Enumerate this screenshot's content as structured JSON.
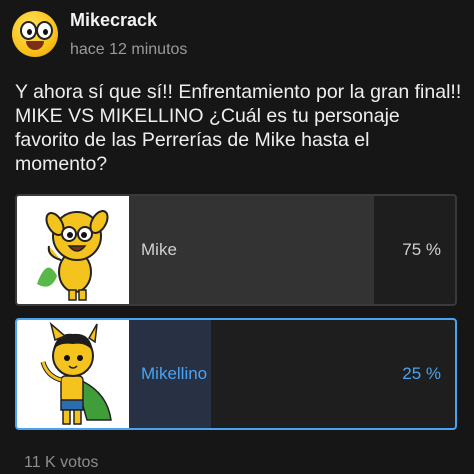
{
  "post": {
    "author": "Mikecrack",
    "time": "hace 12 minutos",
    "text": "Y ahora sí que sí!! Enfrentamiento por la gran final!! MIKE VS MIKELLINO ¿Cuál es tu personaje favorito de las Perrerías de Mike hasta el momento?"
  },
  "poll": {
    "options": [
      {
        "label": "Mike",
        "percent_label": "75 %",
        "fraction": 0.75,
        "selected": false,
        "image": "mike-character-icon"
      },
      {
        "label": "Mikellino",
        "percent_label": "25 %",
        "fraction": 0.25,
        "selected": true,
        "image": "mikellino-character-icon"
      }
    ],
    "votes": "11 K votos"
  },
  "colors": {
    "accent": "#4aa3f0",
    "background": "#161616"
  }
}
